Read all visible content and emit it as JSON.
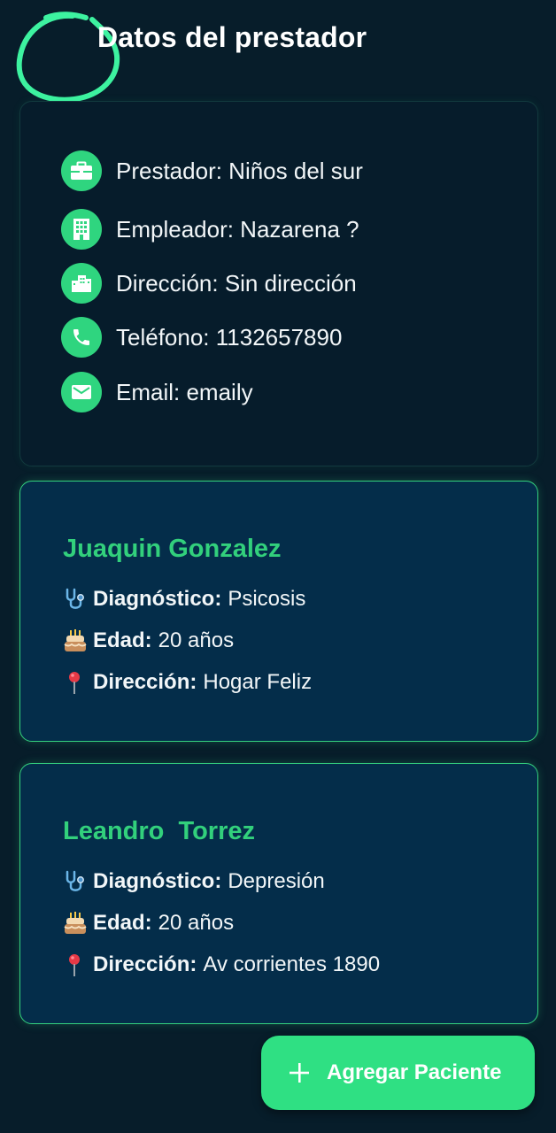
{
  "header": {
    "title": "Datos del prestador"
  },
  "provider": {
    "rows": [
      {
        "icon": "briefcase-icon",
        "text": "Prestador: Niños del sur"
      },
      {
        "icon": "building-icon",
        "text": "Empleador: Nazarena ?"
      },
      {
        "icon": "location-city-icon",
        "text": "Dirección: Sin dirección"
      },
      {
        "icon": "phone-icon",
        "text": "Teléfono: 1132657890"
      },
      {
        "icon": "email-icon",
        "text": "Email: emaily"
      }
    ]
  },
  "patients": [
    {
      "name": "Juaquin Gonzalez",
      "diagnosis_label": "Diagnóstico:",
      "diagnosis": "Psicosis",
      "age_label": "Edad:",
      "age": "20 años",
      "address_label": "Dirección:",
      "address": "Hogar Feliz"
    },
    {
      "name": "Leandro  Torrez",
      "diagnosis_label": "Diagnóstico:",
      "diagnosis": "Depresión",
      "age_label": "Edad:",
      "age": "20 años",
      "address_label": "Dirección:",
      "address": "Av corrientes 1890"
    }
  ],
  "emojis": {
    "diagnosis": "stethoscope-icon",
    "age": "birthday-cake-icon",
    "address": "pin-icon"
  },
  "fab": {
    "label": "Agregar Paciente",
    "icon": "plus-icon"
  },
  "colors": {
    "background": "#071d2a",
    "accent": "#2fd57f",
    "card": "#042d4a",
    "name": "#32d07c"
  }
}
